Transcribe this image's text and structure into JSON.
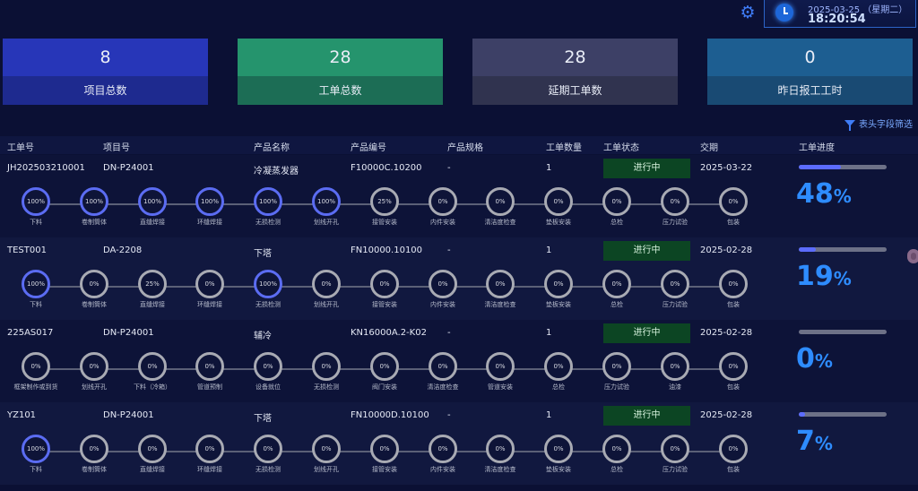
{
  "header": {
    "date": "2025-03-25 （星期二）",
    "time": "18:20:54"
  },
  "stats": [
    {
      "value": "8",
      "label": "项目总数"
    },
    {
      "value": "28",
      "label": "工单总数"
    },
    {
      "value": "28",
      "label": "延期工单数"
    },
    {
      "value": "0",
      "label": "昨日报工工时"
    }
  ],
  "filter_label": "表头字段筛选",
  "columns": [
    "工单号",
    "项目号",
    "产品名称",
    "产品编号",
    "产品规格",
    "工单数量",
    "工单状态",
    "交期",
    "工单进度"
  ],
  "rows": [
    {
      "order_no": "JH202503210001",
      "project_no": "DN-P24001",
      "product_name": "冷凝蒸发器",
      "product_code": "F10000C.10200",
      "spec": "-",
      "quantity": "1",
      "status": "进行中",
      "due": "2025-03-22",
      "progress": 48,
      "progress_text": "48",
      "steps": [
        {
          "label": "下料",
          "value": "100%",
          "done": true
        },
        {
          "label": "卷制筒体",
          "value": "100%",
          "done": true
        },
        {
          "label": "直缝焊接",
          "value": "100%",
          "done": true
        },
        {
          "label": "环缝焊接",
          "value": "100%",
          "done": true
        },
        {
          "label": "无损检测",
          "value": "100%",
          "done": true
        },
        {
          "label": "划线开孔",
          "value": "100%",
          "done": true
        },
        {
          "label": "接管安装",
          "value": "25%",
          "done": false
        },
        {
          "label": "内件安装",
          "value": "0%",
          "done": false
        },
        {
          "label": "清洁度检查",
          "value": "0%",
          "done": false
        },
        {
          "label": "垫板安装",
          "value": "0%",
          "done": false
        },
        {
          "label": "总检",
          "value": "0%",
          "done": false
        },
        {
          "label": "压力试验",
          "value": "0%",
          "done": false
        },
        {
          "label": "包装",
          "value": "0%",
          "done": false
        }
      ]
    },
    {
      "order_no": "TEST001",
      "project_no": "DA-2208",
      "product_name": "下塔",
      "product_code": "FN10000.10100",
      "spec": "-",
      "quantity": "1",
      "status": "进行中",
      "due": "2025-02-28",
      "progress": 19,
      "progress_text": "19",
      "steps": [
        {
          "label": "下料",
          "value": "100%",
          "done": true
        },
        {
          "label": "卷制筒体",
          "value": "0%",
          "done": false
        },
        {
          "label": "直缝焊接",
          "value": "25%",
          "done": false
        },
        {
          "label": "环缝焊接",
          "value": "0%",
          "done": false
        },
        {
          "label": "无损检测",
          "value": "100%",
          "done": true
        },
        {
          "label": "划线开孔",
          "value": "0%",
          "done": false
        },
        {
          "label": "接管安装",
          "value": "0%",
          "done": false
        },
        {
          "label": "内件安装",
          "value": "0%",
          "done": false
        },
        {
          "label": "清洁度检查",
          "value": "0%",
          "done": false
        },
        {
          "label": "垫板安装",
          "value": "0%",
          "done": false
        },
        {
          "label": "总检",
          "value": "0%",
          "done": false
        },
        {
          "label": "压力试验",
          "value": "0%",
          "done": false
        },
        {
          "label": "包装",
          "value": "0%",
          "done": false
        }
      ]
    },
    {
      "order_no": "225AS017",
      "project_no": "DN-P24001",
      "product_name": "辅冷",
      "product_code": "KN16000A.2-K02",
      "spec": "-",
      "quantity": "1",
      "status": "进行中",
      "due": "2025-02-28",
      "progress": 0,
      "progress_text": "0",
      "steps": [
        {
          "label": "框架制作或到货",
          "value": "0%",
          "done": false
        },
        {
          "label": "划线开孔",
          "value": "0%",
          "done": false
        },
        {
          "label": "下料（冷箱）",
          "value": "0%",
          "done": false
        },
        {
          "label": "管道预制",
          "value": "0%",
          "done": false
        },
        {
          "label": "设备就位",
          "value": "0%",
          "done": false
        },
        {
          "label": "无损检测",
          "value": "0%",
          "done": false
        },
        {
          "label": "阀门安装",
          "value": "0%",
          "done": false
        },
        {
          "label": "清洁度检查",
          "value": "0%",
          "done": false
        },
        {
          "label": "管道安装",
          "value": "0%",
          "done": false
        },
        {
          "label": "总检",
          "value": "0%",
          "done": false
        },
        {
          "label": "压力试验",
          "value": "0%",
          "done": false
        },
        {
          "label": "油漆",
          "value": "0%",
          "done": false
        },
        {
          "label": "包装",
          "value": "0%",
          "done": false
        }
      ]
    },
    {
      "order_no": "YZ101",
      "project_no": "DN-P24001",
      "product_name": "下塔",
      "product_code": "FN10000D.10100",
      "spec": "-",
      "quantity": "1",
      "status": "进行中",
      "due": "2025-02-28",
      "progress": 7,
      "progress_text": "7",
      "steps": [
        {
          "label": "下料",
          "value": "100%",
          "done": true
        },
        {
          "label": "卷制筒体",
          "value": "0%",
          "done": false
        },
        {
          "label": "直缝焊接",
          "value": "0%",
          "done": false
        },
        {
          "label": "环缝焊接",
          "value": "0%",
          "done": false
        },
        {
          "label": "无损检测",
          "value": "0%",
          "done": false
        },
        {
          "label": "划线开孔",
          "value": "0%",
          "done": false
        },
        {
          "label": "接管安装",
          "value": "0%",
          "done": false
        },
        {
          "label": "内件安装",
          "value": "0%",
          "done": false
        },
        {
          "label": "清洁度检查",
          "value": "0%",
          "done": false
        },
        {
          "label": "垫板安装",
          "value": "0%",
          "done": false
        },
        {
          "label": "总检",
          "value": "0%",
          "done": false
        },
        {
          "label": "压力试验",
          "value": "0%",
          "done": false
        },
        {
          "label": "包装",
          "value": "0%",
          "done": false
        }
      ]
    }
  ]
}
